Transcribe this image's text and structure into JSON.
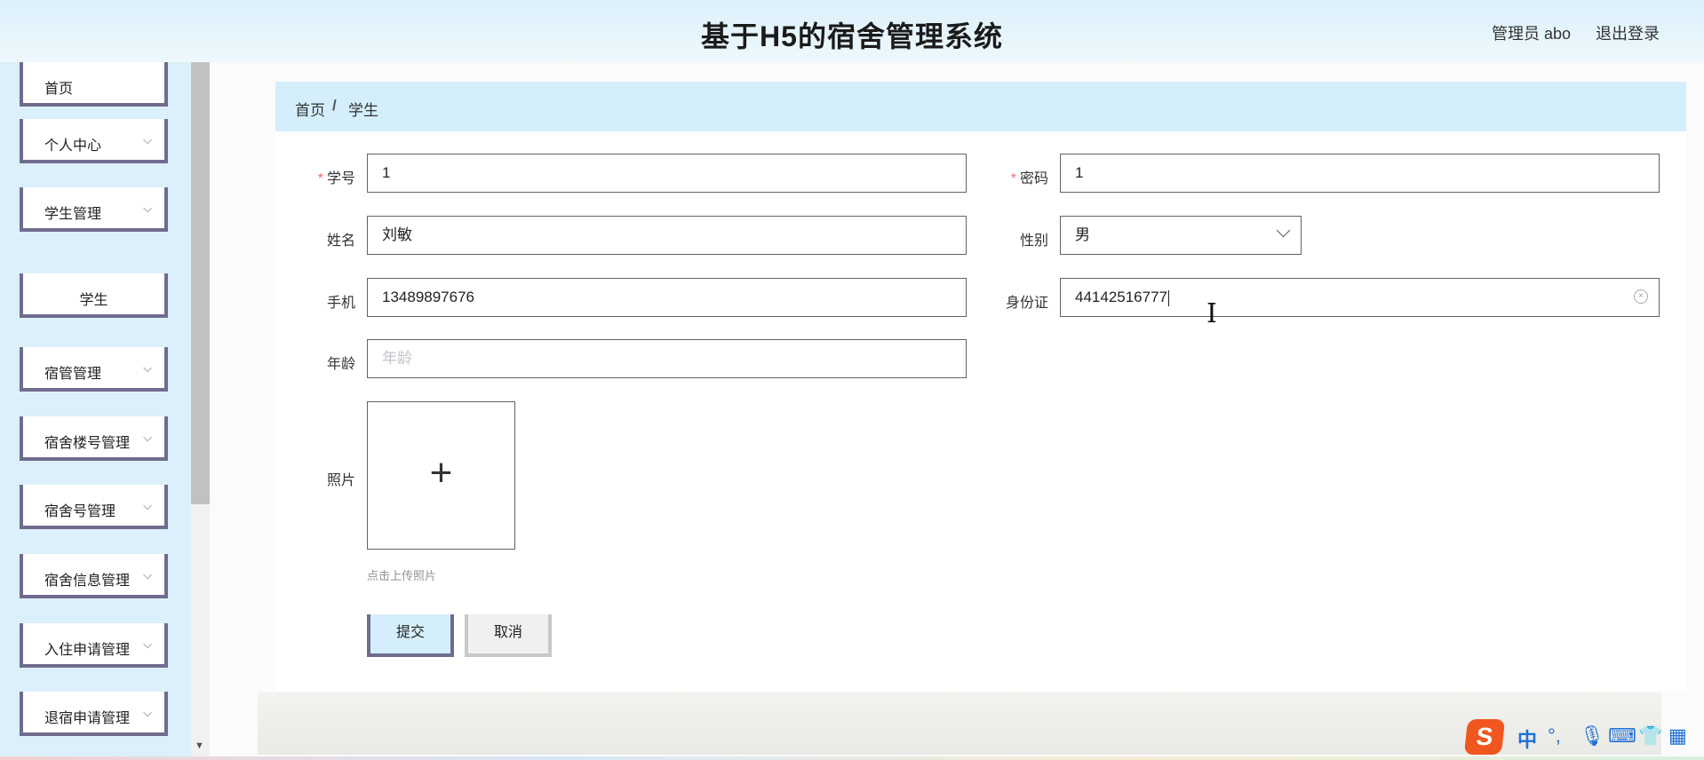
{
  "header": {
    "title": "基于H5的宿舍管理系统",
    "user": "管理员 abo",
    "logout": "退出登录"
  },
  "sidebar": {
    "items": [
      {
        "label": "首页"
      },
      {
        "label": "个人中心"
      },
      {
        "label": "学生管理"
      },
      {
        "label": "学生"
      },
      {
        "label": "宿管管理"
      },
      {
        "label": "宿舍楼号管理"
      },
      {
        "label": "宿舍号管理"
      },
      {
        "label": "宿舍信息管理"
      },
      {
        "label": "入住申请管理"
      },
      {
        "label": "退宿申请管理"
      }
    ]
  },
  "breadcrumb": {
    "home": "首页",
    "separator": "/",
    "current": "学生"
  },
  "form": {
    "student_no": {
      "label": "学号",
      "value": "1"
    },
    "password": {
      "label": "密码",
      "value": "1"
    },
    "name": {
      "label": "姓名",
      "value": "刘敏"
    },
    "gender": {
      "label": "性别",
      "value": "男"
    },
    "phone": {
      "label": "手机",
      "value": "13489897676"
    },
    "id_card": {
      "label": "身份证",
      "value": "44142516777"
    },
    "age": {
      "label": "年龄",
      "placeholder": "年龄"
    },
    "photo": {
      "label": "照片",
      "tip": "点击上传照片"
    },
    "submit": "提交",
    "cancel": "取消"
  },
  "ime": {
    "mode": "中",
    "punct": "°,"
  },
  "colors": {
    "accent": "#d4effb",
    "border_accent": "#6f6c8e",
    "required": "#f56c6c"
  }
}
